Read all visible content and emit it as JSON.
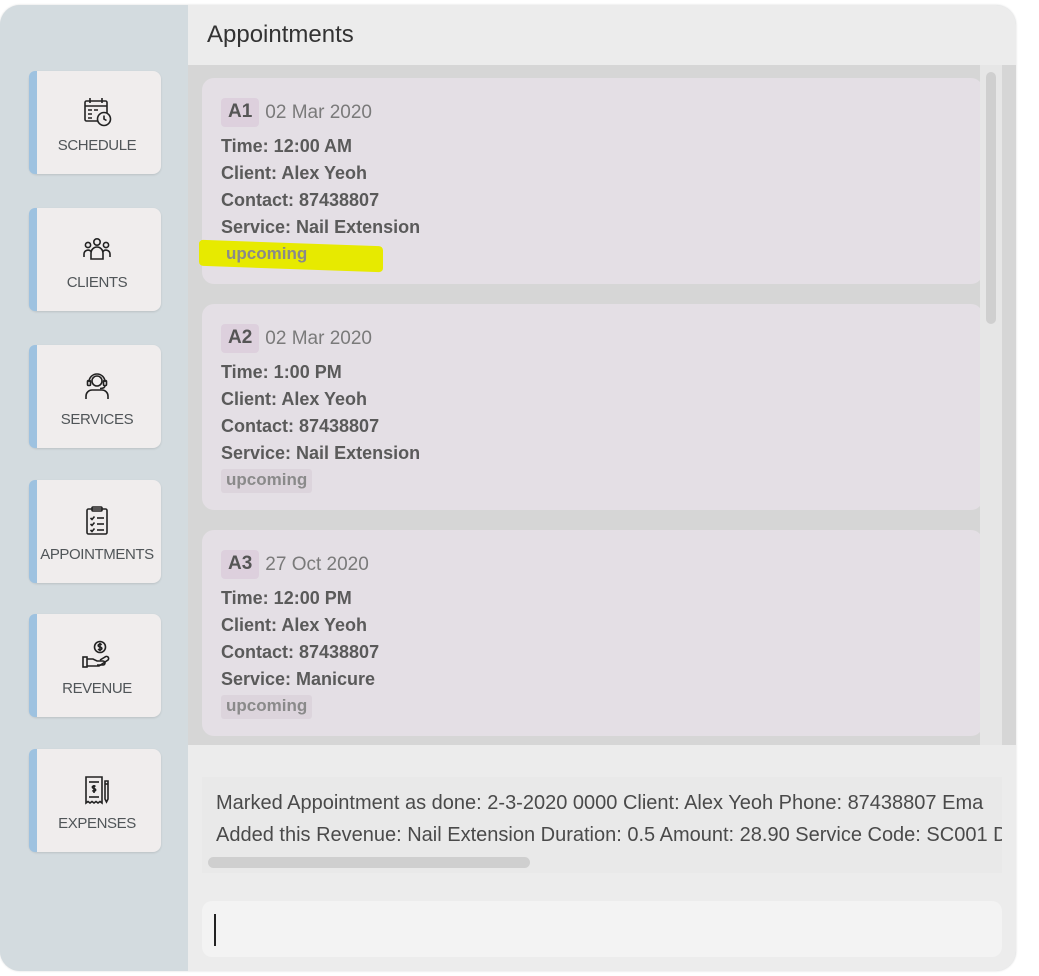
{
  "sidebar": {
    "items": [
      {
        "label": "SCHEDULE",
        "icon": "calendar-clock-icon"
      },
      {
        "label": "CLIENTS",
        "icon": "people-group-icon"
      },
      {
        "label": "SERVICES",
        "icon": "headset-person-icon"
      },
      {
        "label": "APPOINTMENTS",
        "icon": "clipboard-checklist-icon"
      },
      {
        "label": "REVENUE",
        "icon": "hand-dollar-icon"
      },
      {
        "label": "EXPENSES",
        "icon": "receipt-pen-icon"
      }
    ]
  },
  "main": {
    "title": "Appointments",
    "appointments": [
      {
        "id": "A1",
        "date": "02 Mar 2020",
        "time": "Time: 12:00 AM",
        "client": "Client: Alex Yeoh",
        "contact": "Contact: 87438807",
        "service": "Service: Nail Extension",
        "status": "upcoming"
      },
      {
        "id": "A2",
        "date": "02 Mar 2020",
        "time": "Time: 1:00 PM",
        "client": "Client: Alex Yeoh",
        "contact": "Contact: 87438807",
        "service": "Service: Nail Extension",
        "status": "upcoming"
      },
      {
        "id": "A3",
        "date": "27 Oct 2020",
        "time": "Time: 12:00 PM",
        "client": "Client: Alex Yeoh",
        "contact": "Contact: 87438807",
        "service": "Service: Manicure",
        "status": "upcoming"
      }
    ],
    "result": {
      "line1": "Marked Appointment as done: 2-3-2020 0000 Client: Alex Yeoh Phone: 87438807 Ema",
      "line2": "Added this Revenue: Nail Extension Duration: 0.5 Amount: 28.90 Service Code: SC001 D"
    },
    "command": {
      "value": "",
      "placeholder": ""
    }
  },
  "colors": {
    "sidebar_bg": "#d3dbdf",
    "accent": "#9ec2e0",
    "card_bg": "#e4dfe5",
    "highlight": "#e7ea00"
  }
}
